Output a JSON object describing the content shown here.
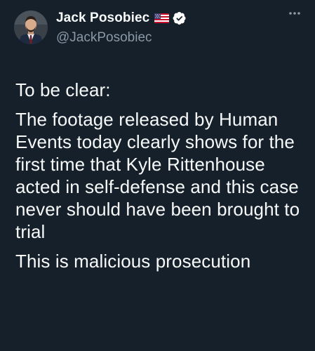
{
  "author": {
    "display_name": "Jack Posobiec",
    "handle": "@JackPosobiec",
    "flag_icon": "us-flag-icon",
    "verified_icon": "verified-badge-icon",
    "verified_color": "#ffffff"
  },
  "menu": {
    "icon": "more-options-icon"
  },
  "tweet": {
    "paragraphs": [
      "To be clear:",
      "The footage released by Human Events today clearly shows for the first time that Kyle Rittenhouse acted in self-defense and this case never should have been brought to trial",
      "This is malicious prosecution"
    ]
  },
  "colors": {
    "background": "#15202b",
    "text": "#f7f9f9",
    "secondary_text": "#8b98a5"
  }
}
